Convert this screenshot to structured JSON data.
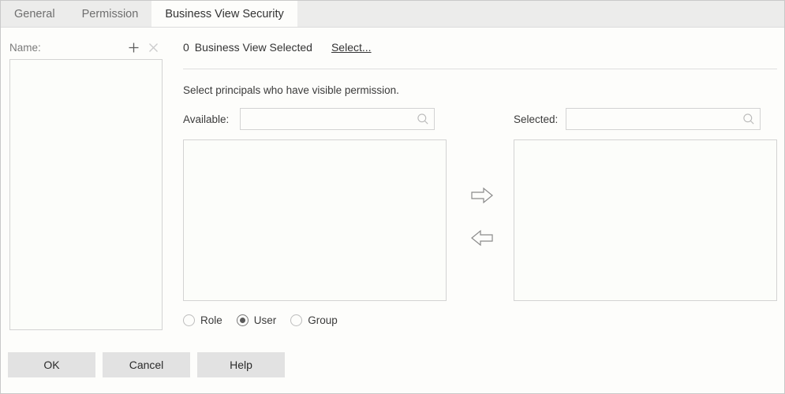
{
  "tabs": [
    {
      "label": "General",
      "active": false
    },
    {
      "label": "Permission",
      "active": false
    },
    {
      "label": "Business View Security",
      "active": true
    }
  ],
  "left_panel": {
    "name_label": "Name:",
    "add_icon": "plus-icon",
    "delete_icon": "close-icon",
    "list_items": []
  },
  "right_panel": {
    "business_view_count": "0",
    "business_view_text": "Business View Selected",
    "select_link": "Select...",
    "instruction": "Select principals who have visible permission.",
    "available": {
      "label": "Available:",
      "value": "",
      "placeholder": "",
      "search_icon": "search-icon",
      "list_items": []
    },
    "selected": {
      "label": "Selected:",
      "value": "",
      "placeholder": "",
      "search_icon": "search-icon",
      "list_items": []
    },
    "arrows": {
      "move_right": "arrow-right-icon",
      "move_left": "arrow-left-icon"
    },
    "principal_types": [
      {
        "label": "Role",
        "checked": false
      },
      {
        "label": "User",
        "checked": true
      },
      {
        "label": "Group",
        "checked": false
      }
    ]
  },
  "footer": {
    "ok": "OK",
    "cancel": "Cancel",
    "help": "Help"
  },
  "colors": {
    "tabstrip_bg": "#ececeb",
    "active_tab_bg": "#fdfdfb",
    "page_bg": "#fdfdfb",
    "border": "#d3d3d3",
    "button_bg": "#e2e2e2",
    "text": "#333333",
    "muted_text": "#7a7a7a"
  }
}
